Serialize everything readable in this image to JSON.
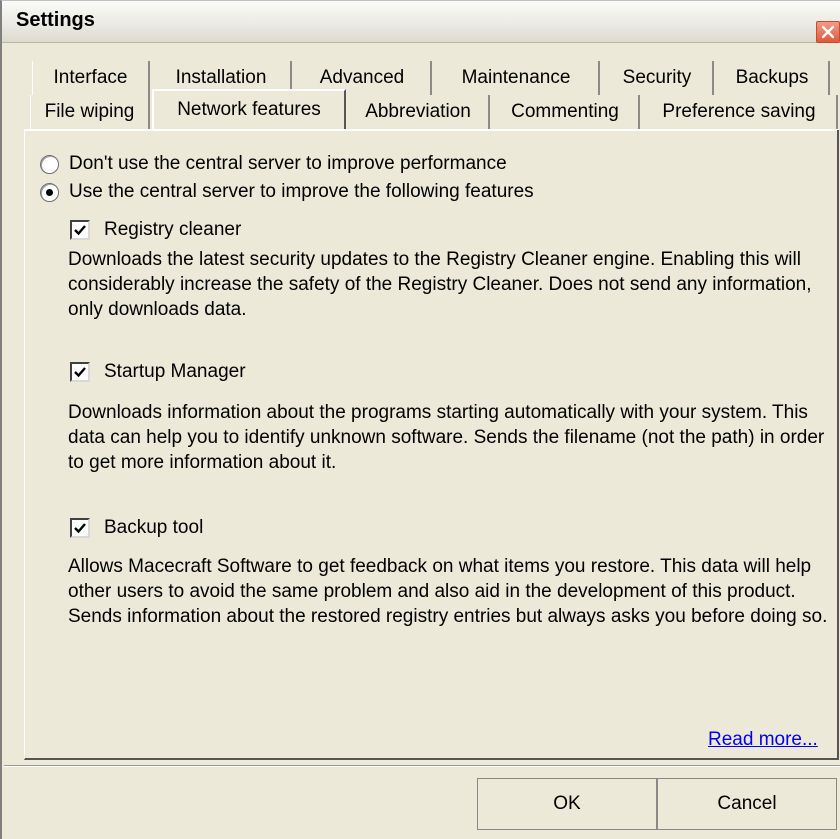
{
  "window": {
    "title": "Settings",
    "close_icon": "close-icon",
    "close_color": "#e2573b"
  },
  "tabs": {
    "row1": [
      "Interface",
      "Installation",
      "Advanced",
      "Maintenance",
      "Security",
      "Backups"
    ],
    "row2": [
      "File wiping",
      "Network features",
      "Abbreviation",
      "Commenting",
      "Preference saving"
    ],
    "selected": "Network features"
  },
  "network": {
    "option_off": "Don't use the central server to improve performance",
    "option_on": "Use the central server to improve the following features",
    "selected_option": "on",
    "features": [
      {
        "label": "Registry cleaner",
        "checked": true,
        "description": "Downloads the latest security updates to the Registry Cleaner engine. Enabling this will considerably increase the safety of the Registry Cleaner. Does not send any information, only downloads data."
      },
      {
        "label": "Startup Manager",
        "checked": true,
        "description": "Downloads information about the programs starting automatically with your system. This data can help you to identify unknown software. Sends the filename (not the path) in order to get more information about it."
      },
      {
        "label": "Backup tool",
        "checked": true,
        "description": "Allows Macecraft Software to get feedback on what items you restore. This data will help other users to avoid the same problem and also aid in the development of this product. Sends information about the restored registry entries but always asks you before doing so."
      }
    ],
    "read_more": "Read more..."
  },
  "buttons": {
    "ok": "OK",
    "cancel": "Cancel"
  }
}
